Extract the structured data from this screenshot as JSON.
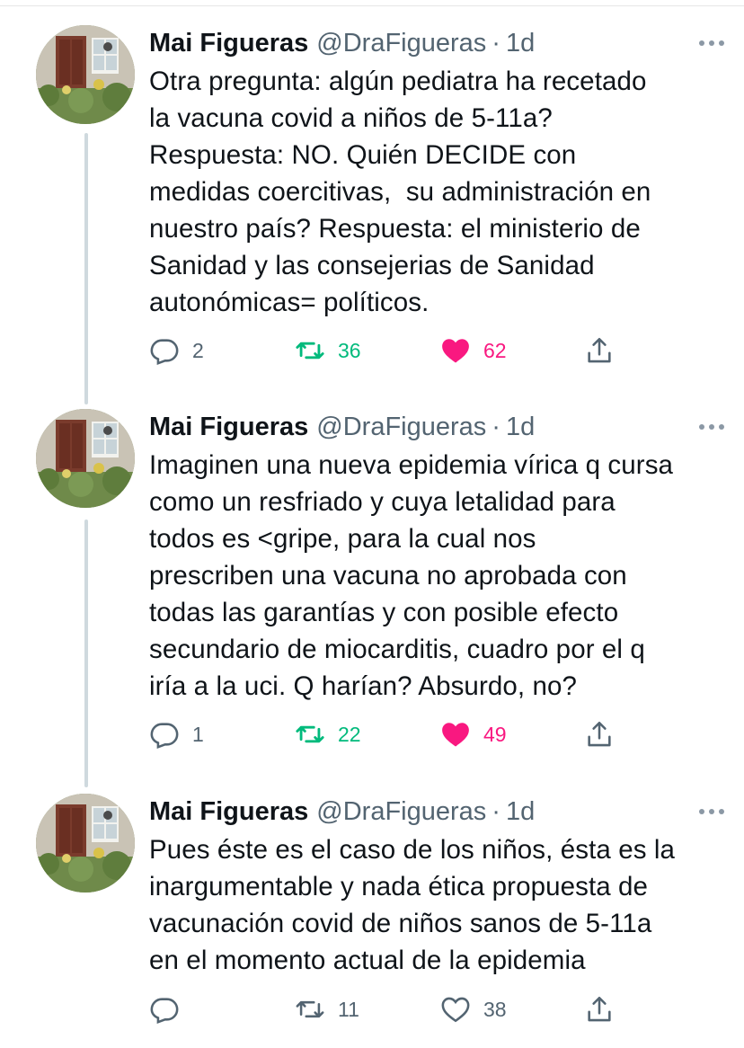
{
  "colors": {
    "text": "#0f1419",
    "secondary": "#536471",
    "retweet_active": "#00ba7c",
    "like_active": "#f91880",
    "thread_line": "#cfd9de"
  },
  "tweets": [
    {
      "name": "Mai Figueras",
      "handle": "@DraFigueras",
      "dot": "·",
      "time": "1d",
      "text": "Otra pregunta: algún pediatra ha recetado\nla vacuna covid a niños de 5-11a?\nRespuesta: NO. Quién DECIDE con\nmedidas coercitivas,  su administración en\nnuestro país? Respuesta: el ministerio de\nSanidad y las consejerias de Sanidad\nautonómicas= políticos.",
      "replies": "2",
      "retweets": "36",
      "likes": "62",
      "retweeted": true,
      "liked": true
    },
    {
      "name": "Mai Figueras",
      "handle": "@DraFigueras",
      "dot": "·",
      "time": "1d",
      "text": "Imaginen una nueva epidemia vírica q cursa\ncomo un resfriado y cuya letalidad para\ntodos es <gripe, para la cual nos\nprescriben una vacuna no aprobada con\ntodas las garantías y con posible efecto\nsecundario de miocarditis, cuadro por el q\niría a la uci. Q harían? Absurdo, no?",
      "replies": "1",
      "retweets": "22",
      "likes": "49",
      "retweeted": true,
      "liked": true
    },
    {
      "name": "Mai Figueras",
      "handle": "@DraFigueras",
      "dot": "·",
      "time": "1d",
      "text": "Pues éste es el caso de los niños, ésta es la\ninargumentable y nada ética propuesta de\nvacunación covid de niños sanos de 5-11a\nen el momento actual de la epidemia",
      "replies": "",
      "retweets": "11",
      "likes": "38",
      "retweeted": false,
      "liked": false
    }
  ]
}
